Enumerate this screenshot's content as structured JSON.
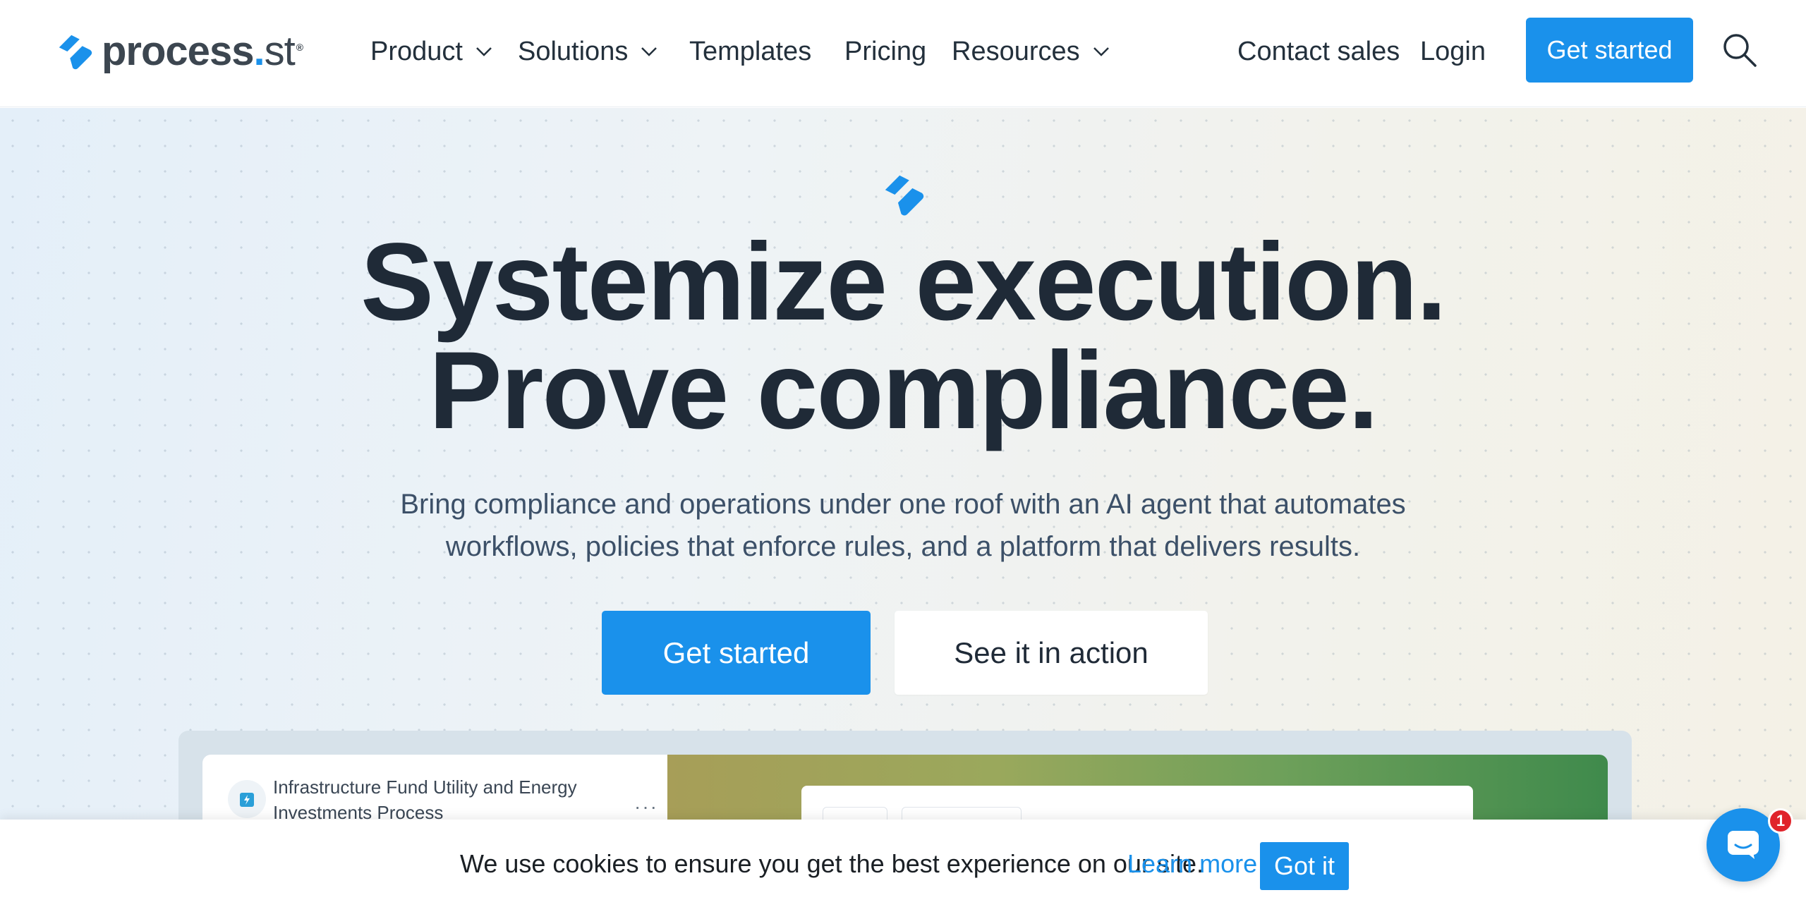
{
  "colors": {
    "brand_blue": "#1a91eb",
    "heading": "#1f2a37",
    "badge_red": "#e0242b"
  },
  "nav": {
    "logo": {
      "name": "process",
      "dot": ".",
      "suffix": "st",
      "reg": "®"
    },
    "items": [
      {
        "label": "Product",
        "has_dropdown": true
      },
      {
        "label": "Solutions",
        "has_dropdown": true
      },
      {
        "label": "Templates",
        "has_dropdown": false
      },
      {
        "label": "Pricing",
        "has_dropdown": false
      },
      {
        "label": "Resources",
        "has_dropdown": true
      }
    ],
    "contact_sales": "Contact sales",
    "login": "Login",
    "cta": "Get started",
    "search_icon": "search-icon"
  },
  "hero": {
    "title_line1": "Systemize execution.",
    "title_line2": "Prove compliance.",
    "subtitle": "Bring compliance and operations under one roof with an AI agent that automates workflows, policies that enforce rules, and a platform that delivers results.",
    "primary_cta": "Get started",
    "secondary_cta": "See it in action"
  },
  "preview": {
    "workflow_title": "Infrastructure Fund Utility and Energy Investments Process",
    "more": "···"
  },
  "cookie": {
    "text": "We use cookies to ensure you get the best experience on our site.",
    "link": "Learn more",
    "button": "Got it"
  },
  "chat": {
    "badge_count": "1"
  }
}
